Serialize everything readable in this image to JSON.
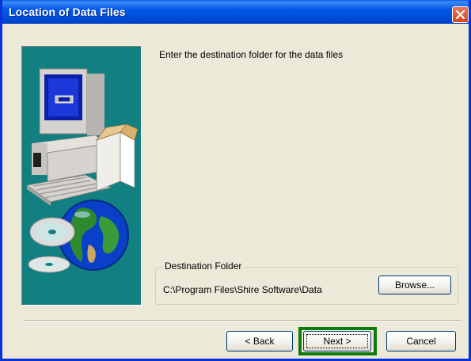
{
  "window": {
    "title": "Location of Data Files"
  },
  "content": {
    "instruction": "Enter the destination folder for the data files"
  },
  "destination": {
    "group_label": "Destination Folder",
    "path": "C:\\Program Files\\Shire Software\\Data",
    "browse_label": "Browse..."
  },
  "buttons": {
    "back_label": "< Back",
    "next_label": "Next >",
    "cancel_label": "Cancel"
  },
  "colors": {
    "banner": "#128080",
    "titlebar": "#0058e6",
    "highlight": "#0e7a0e"
  },
  "icons": {
    "close": "close-icon",
    "banner": "computer-globe-illustration"
  }
}
